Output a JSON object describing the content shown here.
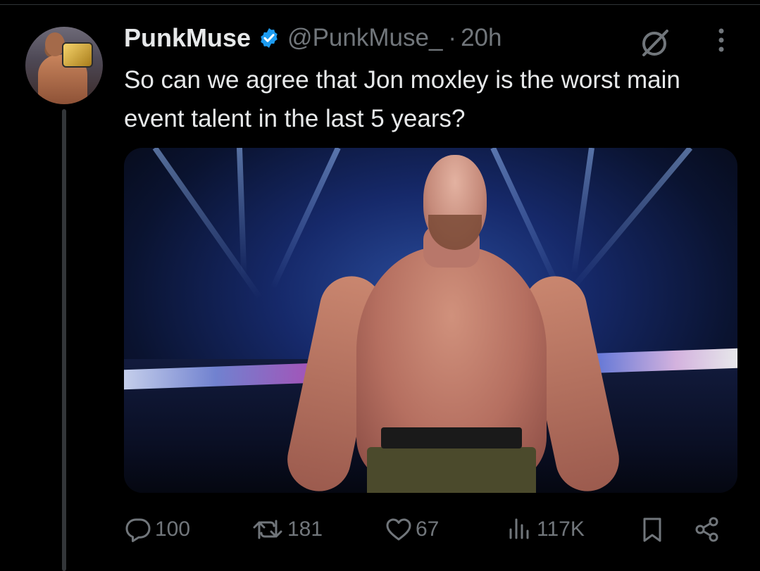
{
  "tweet": {
    "author_name": "PunkMuse",
    "handle": "@PunkMuse_",
    "separator": "·",
    "time": "20h",
    "text": "So can we agree that Jon moxley is the worst main event talent in the last 5 years?"
  },
  "actions": {
    "replies": "100",
    "retweets": "181",
    "likes": "67",
    "views": "117K"
  },
  "colors": {
    "background": "#000000",
    "primary_text": "#e7e9ea",
    "secondary_text": "#71767b",
    "verified": "#1d9bf0"
  },
  "icons": [
    "verified-badge-icon",
    "grok-icon",
    "more-icon",
    "reply-icon",
    "retweet-icon",
    "like-icon",
    "views-icon",
    "bookmark-icon",
    "share-icon"
  ]
}
